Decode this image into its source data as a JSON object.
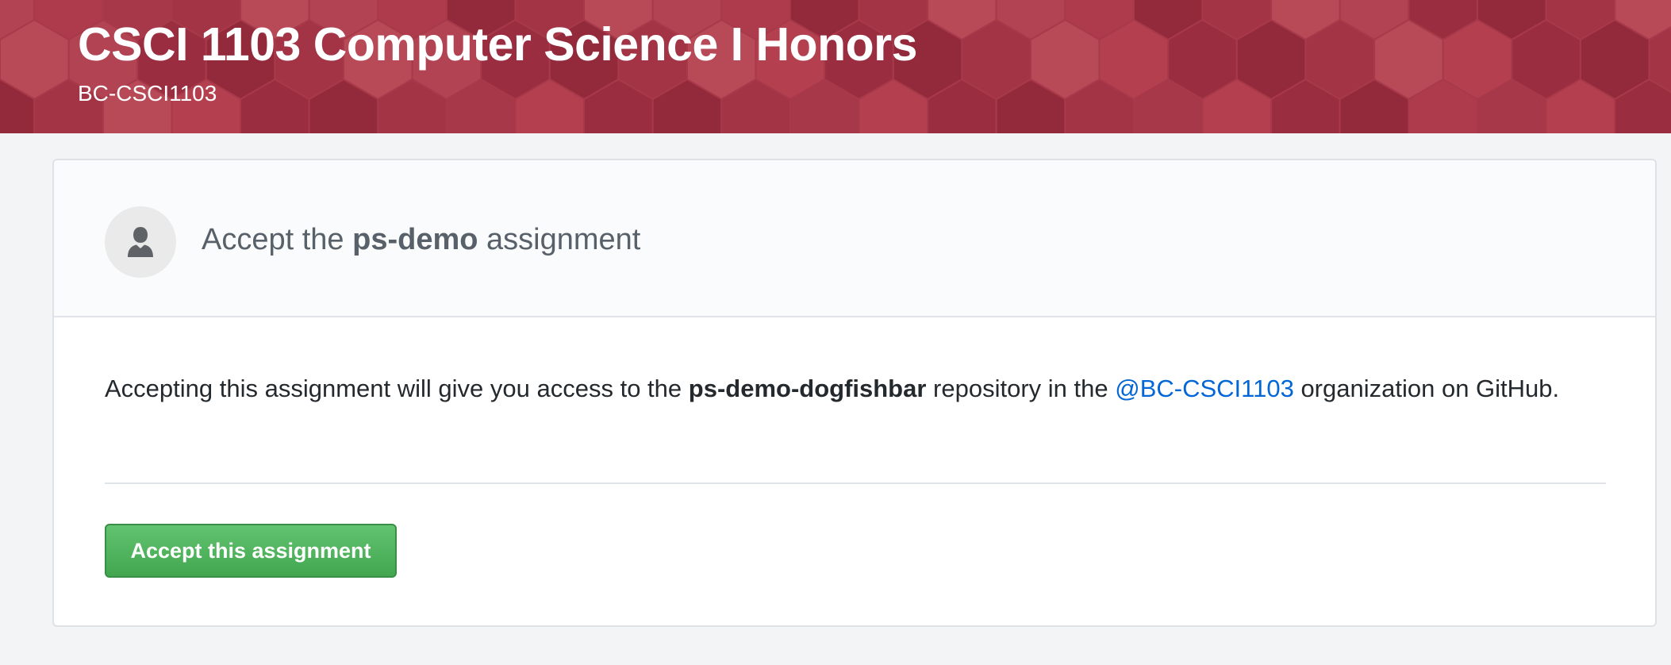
{
  "banner": {
    "title": "CSCI 1103 Computer Science I Honors",
    "subtitle": "BC-CSCI1103",
    "color": "#a8394a"
  },
  "card": {
    "header": {
      "prefix": "Accept the ",
      "assignment_name": "ps-demo",
      "suffix": " assignment",
      "avatar_icon": "user-icon"
    },
    "description": {
      "part1": "Accepting this assignment will give you access to the ",
      "repo_name": "ps-demo-dogfishbar",
      "part2": " repository in the ",
      "org_link": "@BC-CSCI1103",
      "part3": " organization on GitHub."
    },
    "accept_button_label": "Accept this assignment"
  },
  "colors": {
    "accept_button": "#42a64f",
    "link": "#0366d6"
  }
}
